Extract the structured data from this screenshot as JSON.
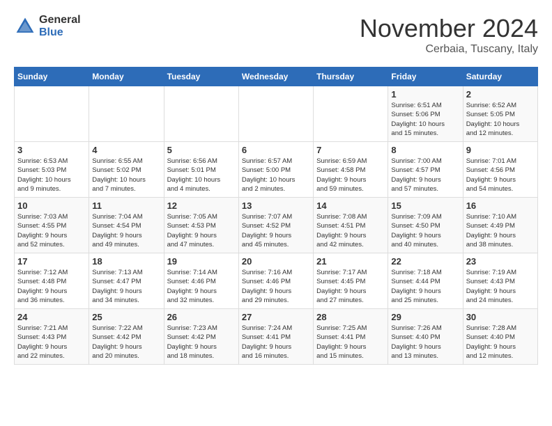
{
  "logo": {
    "general": "General",
    "blue": "Blue"
  },
  "title": "November 2024",
  "location": "Cerbaia, Tuscany, Italy",
  "headers": [
    "Sunday",
    "Monday",
    "Tuesday",
    "Wednesday",
    "Thursday",
    "Friday",
    "Saturday"
  ],
  "rows": [
    [
      {
        "day": "",
        "info": ""
      },
      {
        "day": "",
        "info": ""
      },
      {
        "day": "",
        "info": ""
      },
      {
        "day": "",
        "info": ""
      },
      {
        "day": "",
        "info": ""
      },
      {
        "day": "1",
        "info": "Sunrise: 6:51 AM\nSunset: 5:06 PM\nDaylight: 10 hours\nand 15 minutes."
      },
      {
        "day": "2",
        "info": "Sunrise: 6:52 AM\nSunset: 5:05 PM\nDaylight: 10 hours\nand 12 minutes."
      }
    ],
    [
      {
        "day": "3",
        "info": "Sunrise: 6:53 AM\nSunset: 5:03 PM\nDaylight: 10 hours\nand 9 minutes."
      },
      {
        "day": "4",
        "info": "Sunrise: 6:55 AM\nSunset: 5:02 PM\nDaylight: 10 hours\nand 7 minutes."
      },
      {
        "day": "5",
        "info": "Sunrise: 6:56 AM\nSunset: 5:01 PM\nDaylight: 10 hours\nand 4 minutes."
      },
      {
        "day": "6",
        "info": "Sunrise: 6:57 AM\nSunset: 5:00 PM\nDaylight: 10 hours\nand 2 minutes."
      },
      {
        "day": "7",
        "info": "Sunrise: 6:59 AM\nSunset: 4:58 PM\nDaylight: 9 hours\nand 59 minutes."
      },
      {
        "day": "8",
        "info": "Sunrise: 7:00 AM\nSunset: 4:57 PM\nDaylight: 9 hours\nand 57 minutes."
      },
      {
        "day": "9",
        "info": "Sunrise: 7:01 AM\nSunset: 4:56 PM\nDaylight: 9 hours\nand 54 minutes."
      }
    ],
    [
      {
        "day": "10",
        "info": "Sunrise: 7:03 AM\nSunset: 4:55 PM\nDaylight: 9 hours\nand 52 minutes."
      },
      {
        "day": "11",
        "info": "Sunrise: 7:04 AM\nSunset: 4:54 PM\nDaylight: 9 hours\nand 49 minutes."
      },
      {
        "day": "12",
        "info": "Sunrise: 7:05 AM\nSunset: 4:53 PM\nDaylight: 9 hours\nand 47 minutes."
      },
      {
        "day": "13",
        "info": "Sunrise: 7:07 AM\nSunset: 4:52 PM\nDaylight: 9 hours\nand 45 minutes."
      },
      {
        "day": "14",
        "info": "Sunrise: 7:08 AM\nSunset: 4:51 PM\nDaylight: 9 hours\nand 42 minutes."
      },
      {
        "day": "15",
        "info": "Sunrise: 7:09 AM\nSunset: 4:50 PM\nDaylight: 9 hours\nand 40 minutes."
      },
      {
        "day": "16",
        "info": "Sunrise: 7:10 AM\nSunset: 4:49 PM\nDaylight: 9 hours\nand 38 minutes."
      }
    ],
    [
      {
        "day": "17",
        "info": "Sunrise: 7:12 AM\nSunset: 4:48 PM\nDaylight: 9 hours\nand 36 minutes."
      },
      {
        "day": "18",
        "info": "Sunrise: 7:13 AM\nSunset: 4:47 PM\nDaylight: 9 hours\nand 34 minutes."
      },
      {
        "day": "19",
        "info": "Sunrise: 7:14 AM\nSunset: 4:46 PM\nDaylight: 9 hours\nand 32 minutes."
      },
      {
        "day": "20",
        "info": "Sunrise: 7:16 AM\nSunset: 4:46 PM\nDaylight: 9 hours\nand 29 minutes."
      },
      {
        "day": "21",
        "info": "Sunrise: 7:17 AM\nSunset: 4:45 PM\nDaylight: 9 hours\nand 27 minutes."
      },
      {
        "day": "22",
        "info": "Sunrise: 7:18 AM\nSunset: 4:44 PM\nDaylight: 9 hours\nand 25 minutes."
      },
      {
        "day": "23",
        "info": "Sunrise: 7:19 AM\nSunset: 4:43 PM\nDaylight: 9 hours\nand 24 minutes."
      }
    ],
    [
      {
        "day": "24",
        "info": "Sunrise: 7:21 AM\nSunset: 4:43 PM\nDaylight: 9 hours\nand 22 minutes."
      },
      {
        "day": "25",
        "info": "Sunrise: 7:22 AM\nSunset: 4:42 PM\nDaylight: 9 hours\nand 20 minutes."
      },
      {
        "day": "26",
        "info": "Sunrise: 7:23 AM\nSunset: 4:42 PM\nDaylight: 9 hours\nand 18 minutes."
      },
      {
        "day": "27",
        "info": "Sunrise: 7:24 AM\nSunset: 4:41 PM\nDaylight: 9 hours\nand 16 minutes."
      },
      {
        "day": "28",
        "info": "Sunrise: 7:25 AM\nSunset: 4:41 PM\nDaylight: 9 hours\nand 15 minutes."
      },
      {
        "day": "29",
        "info": "Sunrise: 7:26 AM\nSunset: 4:40 PM\nDaylight: 9 hours\nand 13 minutes."
      },
      {
        "day": "30",
        "info": "Sunrise: 7:28 AM\nSunset: 4:40 PM\nDaylight: 9 hours\nand 12 minutes."
      }
    ]
  ]
}
